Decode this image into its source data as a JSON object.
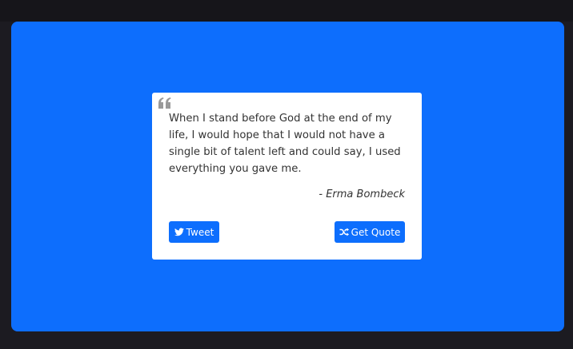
{
  "quote": {
    "text": "When I stand before God at the end of my life, I would hope that I would not have a single bit of talent left and could say, I used everything you gave me.",
    "author": "- Erma Bombeck"
  },
  "buttons": {
    "tweet_label": "Tweet",
    "new_quote_label": "Get Quote"
  },
  "colors": {
    "background": "#1c1b21",
    "panel": "#0d6efd",
    "card": "#ffffff",
    "button": "#0d6efd",
    "text": "#333333",
    "quote_icon": "#999999"
  },
  "icons": {
    "quote_mark": "quote-left-icon",
    "tweet": "twitter-icon",
    "new_quote": "shuffle-icon"
  }
}
